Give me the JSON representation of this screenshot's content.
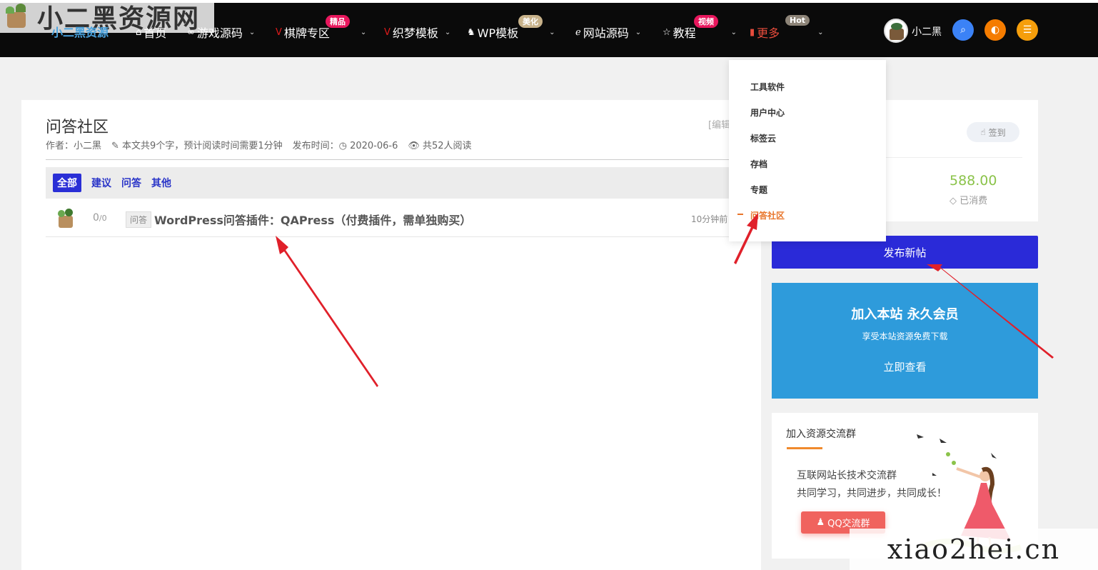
{
  "site": {
    "watermark_top": "小二黑资源网",
    "logo_subtitle": "小二黑资源",
    "watermark_bottom": "xiao2hei.cn"
  },
  "nav": {
    "items": [
      {
        "label": "首页",
        "icon": "home-icon"
      },
      {
        "label": "游戏源码",
        "icon": "gamepad-icon"
      },
      {
        "label": "棋牌专区",
        "icon": "v-icon",
        "badge": "精品"
      },
      {
        "label": "织梦模板",
        "icon": "v-icon"
      },
      {
        "label": "WP模板",
        "icon": "wordpress-icon",
        "badge": "美化"
      },
      {
        "label": "网站源码",
        "icon": "ie-icon"
      },
      {
        "label": "教程",
        "icon": "star-icon",
        "badge": "视频"
      },
      {
        "label": "更多",
        "icon": "bookmark-icon",
        "badge": "Hot"
      }
    ],
    "user_name": "小二黑",
    "colors": {
      "search": "#3b82f6",
      "theme": "#f57c00",
      "menu": "#f59e0b",
      "active": "#e74c3c"
    }
  },
  "dropdown": {
    "items": [
      "工具软件",
      "用户中心",
      "标签云",
      "存档",
      "专题",
      "问答社区"
    ],
    "active_index": 5
  },
  "page": {
    "title": "问答社区",
    "author": "作者：小二黑",
    "word_count": "本文共9个字，预计阅读时间需要1分钟",
    "publish": "发布时间：",
    "date": "2020-06-6",
    "views": "共52人阅读",
    "edit": "[编辑"
  },
  "filters": [
    "全部",
    "建议",
    "问答",
    "其他"
  ],
  "posts": [
    {
      "answers": "0",
      "views": "0",
      "category": "问答",
      "title": "WordPress问答插件：QAPress（付费插件，需单独购买）",
      "time": "10分钟前"
    }
  ],
  "sidebar": {
    "checkin": "签到",
    "spent_value": "588.00",
    "spent_label": "已消费",
    "publish_button": "发布新帖",
    "vip_title": "加入本站 永久会员",
    "vip_sub": "享受本站资源免费下载",
    "vip_link": "立即查看",
    "group_title": "加入资源交流群",
    "group_line1": "互联网站长技术交流群",
    "group_line2": "共同学习，共同进步，共同成长！",
    "qq_button": "QQ交流群"
  }
}
